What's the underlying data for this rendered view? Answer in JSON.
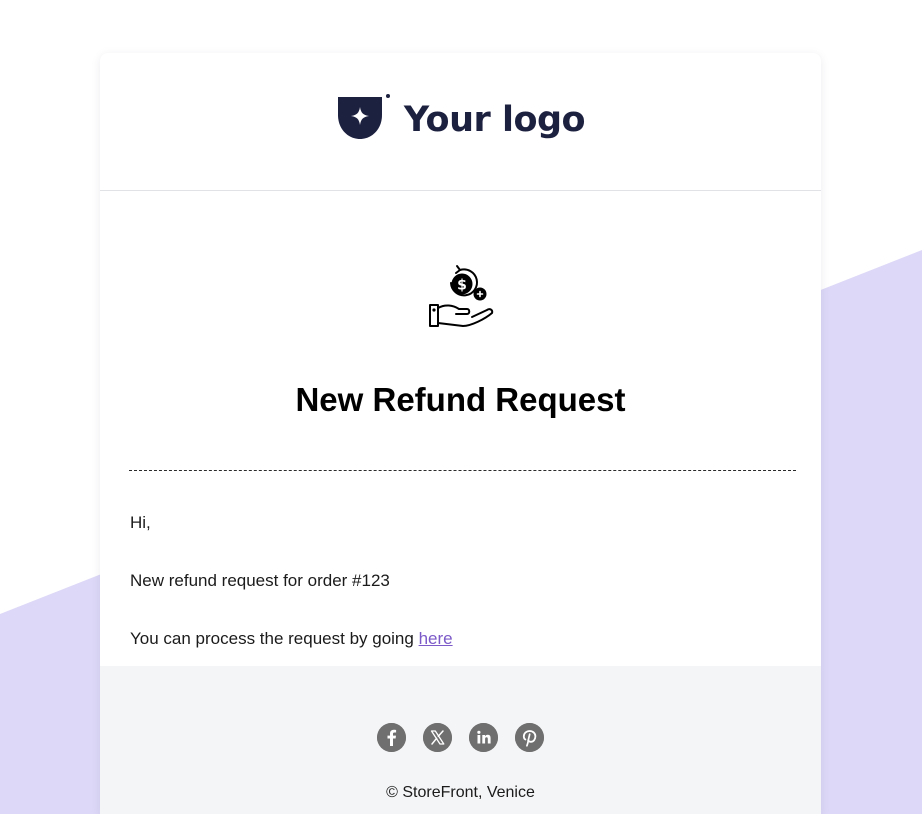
{
  "theme": {
    "background_shape_color": "#ddd8f7",
    "link_color": "#7c5ac8",
    "footer_background": "#f4f5f7"
  },
  "header": {
    "logo_text": "Your logo",
    "logo_icon": "shield-star-icon"
  },
  "body": {
    "icon": "refund-hand-money-icon",
    "title": "New Refund Request",
    "greeting": "Hi,",
    "message": "New refund request for order #123",
    "process_text": "You can process the request by going ",
    "link_text": "here"
  },
  "footer": {
    "social_links": [
      {
        "name": "facebook-icon"
      },
      {
        "name": "x-twitter-icon"
      },
      {
        "name": "linkedin-icon"
      },
      {
        "name": "pinterest-icon"
      }
    ],
    "copyright": "© StoreFront, Venice"
  }
}
